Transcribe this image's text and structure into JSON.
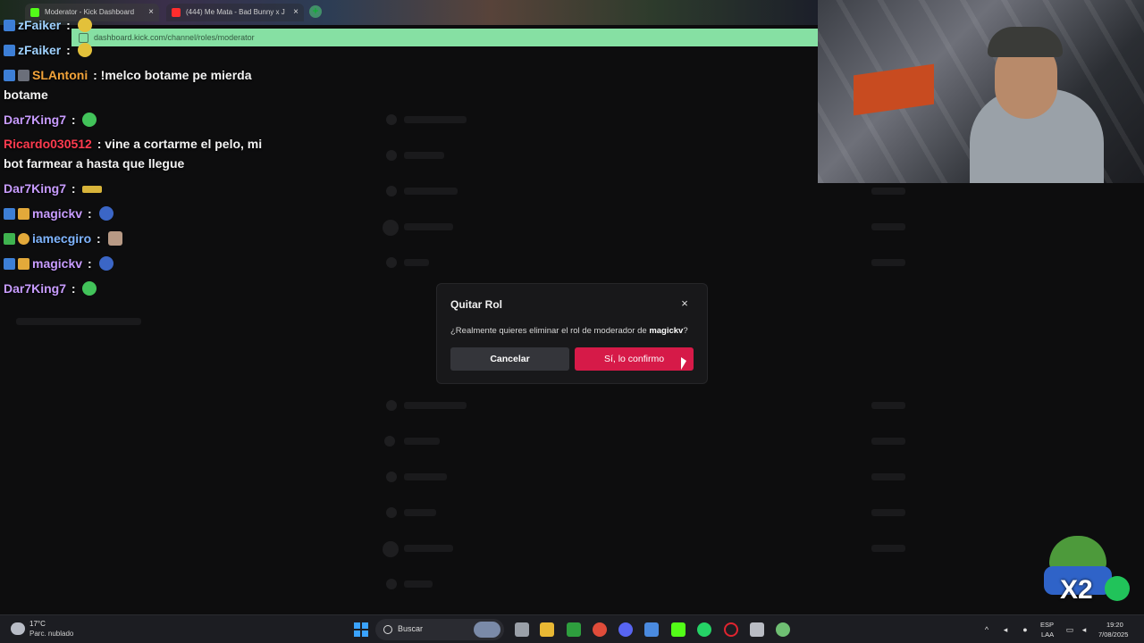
{
  "browser": {
    "tabs": [
      {
        "label": "Moderator - Kick Dashboard",
        "favicon_color": "#53fc18"
      },
      {
        "label": "(444) Me Mata - Bad Bunny x J",
        "favicon_color": "#ff2d2d"
      }
    ],
    "url": "dashboard.kick.com/channel/roles/moderator"
  },
  "chat": {
    "messages": [
      {
        "user": "zFaiker",
        "sep": ":",
        "text": "",
        "user_color": "#9fd2ff"
      },
      {
        "user": "zFaiker",
        "sep": ":",
        "text": "",
        "user_color": "#9fd2ff"
      },
      {
        "user": "SLAntoni",
        "sep": ":",
        "text": "!melco botame pe mierda botame",
        "user_color": "#f2a33a"
      },
      {
        "user": "Dar7King7",
        "sep": ":",
        "text": "",
        "user_color": "#c89cff"
      },
      {
        "user": "Ricardo030512",
        "sep": ":",
        "text": "vine a cortarme el pelo, mi bot farmear a hasta que llegue",
        "user_color": "#ff3b4f"
      },
      {
        "user": "Dar7King7",
        "sep": ":",
        "text": "",
        "user_color": "#c89cff"
      },
      {
        "user": "magickv",
        "sep": ":",
        "text": "",
        "user_color": "#c89cff"
      },
      {
        "user": "iamecgiro",
        "sep": ":",
        "text": "",
        "user_color": "#7fb5ff"
      },
      {
        "user": "magickv",
        "sep": ":",
        "text": "",
        "user_color": "#c89cff"
      },
      {
        "user": "Dar7King7",
        "sep": ":",
        "text": "",
        "user_color": "#c89cff"
      }
    ]
  },
  "modal": {
    "title": "Quitar Rol",
    "question_prefix": "¿Realmente quieres eliminar el rol de moderador de ",
    "target_user": "magickv",
    "question_suffix": "?",
    "cancel_label": "Cancelar",
    "confirm_label": "Sí, lo confirmo",
    "close_glyph": "×",
    "confirm_color": "#d61a48"
  },
  "overlay": {
    "multiplier": "X2"
  },
  "taskbar": {
    "weather_temp": "17°C",
    "weather_desc": "Parc. nublado",
    "search_label": "Buscar",
    "language_top": "ESP",
    "language_bottom": "LAA",
    "time": "19:20",
    "date": "7/08/2025"
  }
}
